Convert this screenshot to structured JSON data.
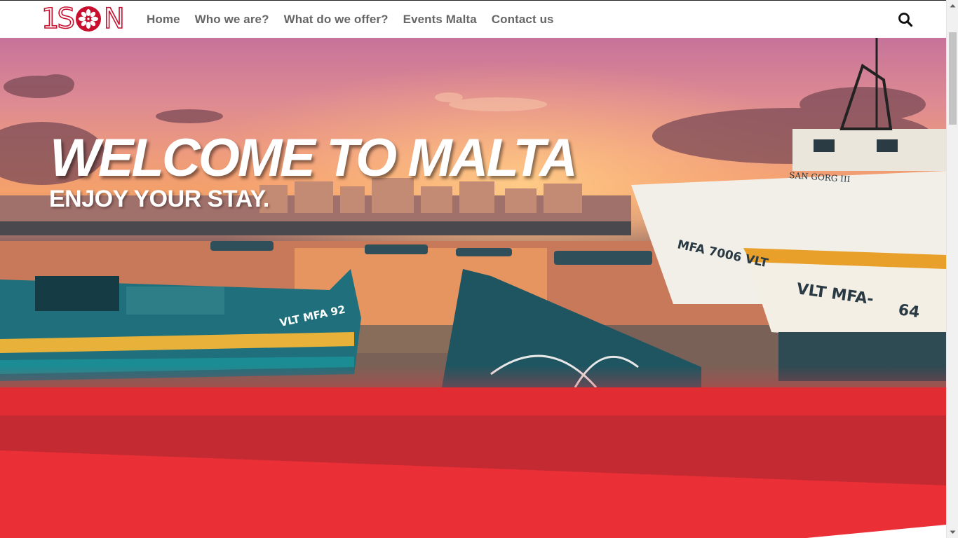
{
  "header": {
    "logo": {
      "text": "1S",
      "text_end": "N",
      "flower_icon": "flower-icon",
      "color": "#c8102e"
    },
    "nav": [
      {
        "label": "Home"
      },
      {
        "label": "Who we are?"
      },
      {
        "label": "What do we offer?"
      },
      {
        "label": "Events Malta"
      },
      {
        "label": "Contact us"
      }
    ],
    "search_icon": "search-icon"
  },
  "hero": {
    "title": "WELCOME TO MALTA",
    "subtitle": "ENJOY YOUR STAY.",
    "boat_labels": [
      "MFA 7006 VLT",
      "VLT MFA-",
      "64",
      "VLT MFA 92",
      "SAN GORG III"
    ]
  },
  "colors": {
    "accent_red": "#ea2f37",
    "dark_red": "#c12a32",
    "nav_text": "#666666"
  },
  "scrollbar": {
    "up_icon": "chevron-up-icon",
    "down_icon": "chevron-down-icon"
  }
}
